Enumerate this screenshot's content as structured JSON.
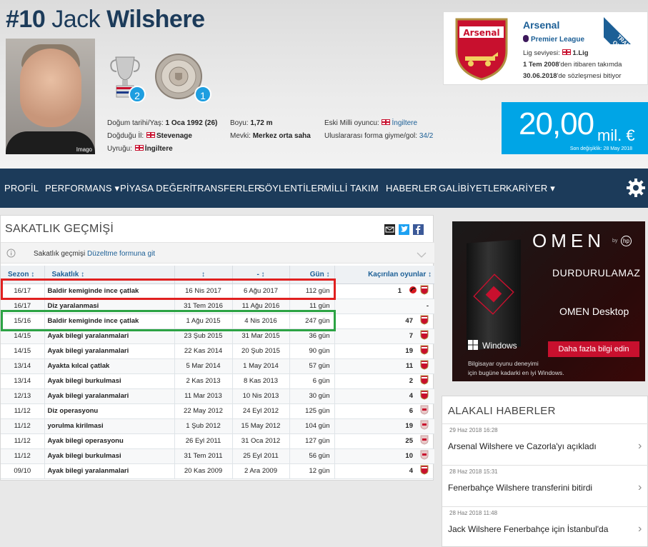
{
  "player": {
    "number": "#10",
    "first_name": "Jack",
    "last_name": "Wilshere",
    "photo_credit": "Imago",
    "trophies": [
      {
        "icon": "fa-cup-icon",
        "count": "2"
      },
      {
        "icon": "community-shield-icon",
        "count": "1"
      }
    ],
    "details": {
      "birth_label": "Doğum tarihi/Yaş:",
      "birth_value": "1 Oca 1992 (26)",
      "birthplace_label": "Doğduğu İl:",
      "birthplace_value": "Stevenage",
      "nationality_label": "Uyruğu:",
      "nationality_value": "İngiltere",
      "height_label": "Boyu:",
      "height_value": "1,72 m",
      "position_label": "Mevki:",
      "position_value": "Merkez orta saha",
      "former_intl_label": "Eski Milli oyuncu:",
      "former_intl_value": "İngiltere",
      "caps_label": "Uluslararası forma giyme/gol:",
      "caps_value": "34/2"
    }
  },
  "club": {
    "name": "Arsenal",
    "league": "Premier League",
    "level_label": "Lig seviyesi:",
    "level_value": "1.Lig",
    "joined_value": "1 Tem 2008",
    "joined_suffix": "'den itibaren takımda",
    "contract_value": "30.06.2018",
    "contract_suffix": "'de sözleşmesi bitiyor",
    "ribbon": "TRANSFER OLUYOR..."
  },
  "market_value": {
    "amount": "20,00",
    "unit": "mil. €",
    "updated": "Son değişiklik: 28 May 2018"
  },
  "nav": [
    "PROFİL",
    "PERFORMANS ▾",
    "PİYASA DEĞERİ",
    "TRANSFERLER",
    "SÖYLENTİLER",
    "MİLLİ TAKIM",
    "HABERLER",
    "GALİBİYETLER",
    "KARİYER ▾"
  ],
  "injury": {
    "title": "SAKATLIK GEÇMİŞİ",
    "edit_prefix": "Sakatlık geçmişi",
    "edit_link": "Düzeltme formuna git",
    "columns": [
      "Sezon ↕",
      "Sakatlık ↕",
      "↕",
      "- ↕",
      "Gün ↕",
      "Kaçırılan oyunlar ↕"
    ],
    "rows": [
      {
        "season": "16/17",
        "injury": "Baldir kemiginde ince çatlak",
        "from": "16 Nis 2017",
        "until": "6 Ağu 2017",
        "days": "112 gün",
        "missed": "1",
        "clubs": [
          "bou",
          "ars"
        ]
      },
      {
        "season": "16/17",
        "injury": "Diz yaralanmasi",
        "from": "31 Tem 2016",
        "until": "11 Ağu 2016",
        "days": "11 gün",
        "missed": "-",
        "clubs": []
      },
      {
        "season": "15/16",
        "injury": "Baldir kemiginde ince çatlak",
        "from": "1 Ağu 2015",
        "until": "4 Nis 2016",
        "days": "247 gün",
        "missed": "47",
        "clubs": [
          "ars"
        ]
      },
      {
        "season": "14/15",
        "injury": "Ayak bilegi yaralanmalari",
        "from": "23 Şub 2015",
        "until": "31 Mar 2015",
        "days": "36 gün",
        "missed": "7",
        "clubs": [
          "ars"
        ]
      },
      {
        "season": "14/15",
        "injury": "Ayak bilegi yaralanmalari",
        "from": "22 Kas 2014",
        "until": "20 Şub 2015",
        "days": "90 gün",
        "missed": "19",
        "clubs": [
          "ars"
        ]
      },
      {
        "season": "13/14",
        "injury": "Ayakta kılcal çatlak",
        "from": "5 Mar 2014",
        "until": "1 May 2014",
        "days": "57 gün",
        "missed": "11",
        "clubs": [
          "ars"
        ]
      },
      {
        "season": "13/14",
        "injury": "Ayak bilegi burkulmasi",
        "from": "2 Kas 2013",
        "until": "8 Kas 2013",
        "days": "6 gün",
        "missed": "2",
        "clubs": [
          "ars"
        ]
      },
      {
        "season": "12/13",
        "injury": "Ayak bilegi yaralanmalari",
        "from": "11 Mar 2013",
        "until": "10 Nis 2013",
        "days": "30 gün",
        "missed": "4",
        "clubs": [
          "ars"
        ]
      },
      {
        "season": "11/12",
        "injury": "Diz operasyonu",
        "from": "22 May 2012",
        "until": "24 Eyl 2012",
        "days": "125 gün",
        "missed": "6",
        "clubs": [
          "ars-old"
        ]
      },
      {
        "season": "11/12",
        "injury": "yorulma kirilmasi",
        "from": "1 Şub 2012",
        "until": "15 May 2012",
        "days": "104 gün",
        "missed": "19",
        "clubs": [
          "ars-old"
        ]
      },
      {
        "season": "11/12",
        "injury": "Ayak bilegi operasyonu",
        "from": "26 Eyl 2011",
        "until": "31 Oca 2012",
        "days": "127 gün",
        "missed": "25",
        "clubs": [
          "ars-old"
        ]
      },
      {
        "season": "11/12",
        "injury": "Ayak bilegi burkulmasi",
        "from": "31 Tem 2011",
        "until": "25 Eyl 2011",
        "days": "56 gün",
        "missed": "10",
        "clubs": [
          "ars-old"
        ]
      },
      {
        "season": "09/10",
        "injury": "Ayak bilegi yaralanmalari",
        "from": "20 Kas 2009",
        "until": "2 Ara 2009",
        "days": "12 gün",
        "missed": "4",
        "clubs": [
          "ars"
        ]
      }
    ]
  },
  "ad": {
    "brand": "OMEN",
    "by": "by",
    "headline": "DURDURULAMAZ",
    "product": "OMEN Desktop",
    "os": "Windows",
    "cta": "Daha fazla bilgi edin",
    "fine1": "Bilgisayar oyunu deneyimi",
    "fine2": "için bugüne kadarki en iyi Windows."
  },
  "news": {
    "title": "ALAKALI HABERLER",
    "items": [
      {
        "date": "29 Haz 2018 16:28",
        "title": "Arsenal Wilshere ve Cazorla'yı açıkladı"
      },
      {
        "date": "28 Haz 2018 15:31",
        "title": "Fenerbahçe Wilshere transferini bitirdi"
      },
      {
        "date": "28 Haz 2018 11:48",
        "title": "Jack Wilshere Fenerbahçe için İstanbul'da"
      }
    ]
  },
  "colors": {
    "navy": "#1c3b5a",
    "accent": "#00a5e6",
    "link": "#1c5f96",
    "red_box": "#e02020",
    "green_box": "#2ca344"
  }
}
